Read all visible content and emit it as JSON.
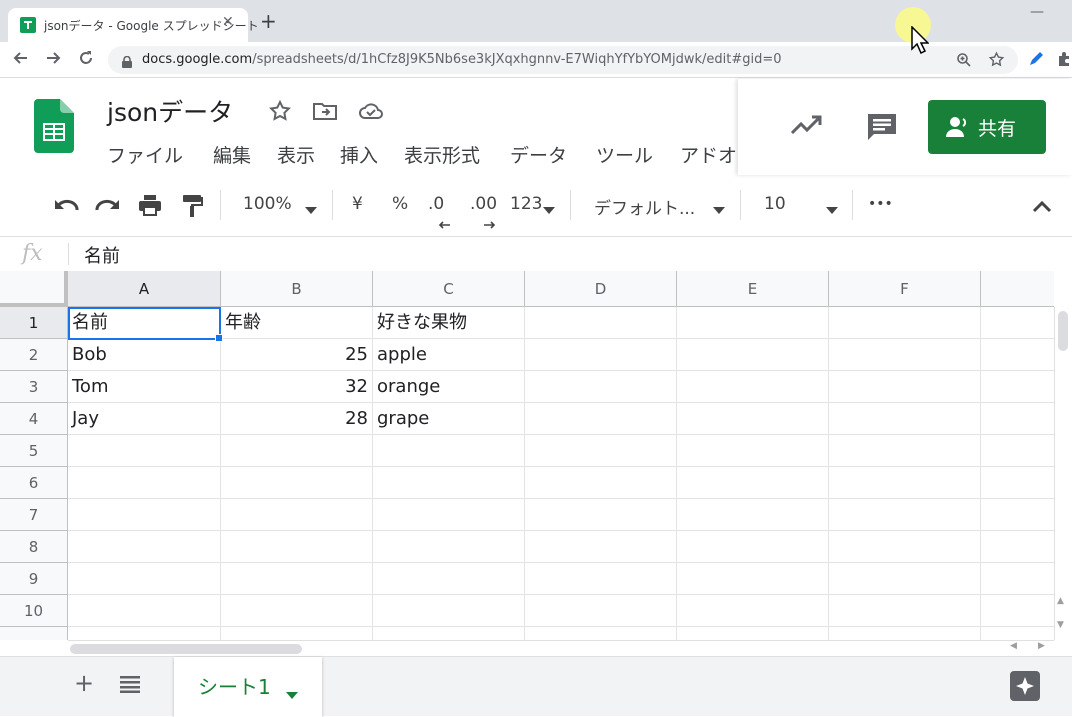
{
  "browser": {
    "tab_title": "jsonデータ - Google スプレッドシート",
    "tab_close": "✕",
    "new_tab": "+",
    "minimize": "—",
    "url_host": "docs.google.com",
    "url_path": "/spreadsheets/d/1hCfz8J9K5Nb6se3kJXqxhgnnv-E7WiqhYfYbYOMjdwk/edit#gid=0"
  },
  "doc": {
    "title": "jsonデータ",
    "menu": [
      "ファイル",
      "編集",
      "表示",
      "挿入",
      "表示形式",
      "データ",
      "ツール",
      "アドオ"
    ],
    "share_label": "共有"
  },
  "toolbar": {
    "zoom": "100%",
    "currency": "¥",
    "percent": "%",
    "decrease_decimal": ".0",
    "increase_decimal": ".00",
    "more_formats": "123",
    "font": "デフォルト...",
    "font_size": "10",
    "more": "•••"
  },
  "formula_bar": {
    "fx": "fx",
    "value": "名前"
  },
  "grid": {
    "columns": [
      "A",
      "B",
      "C",
      "D",
      "E",
      "F"
    ],
    "row_numbers": [
      "1",
      "2",
      "3",
      "4",
      "5",
      "6",
      "7",
      "8",
      "9",
      "10"
    ],
    "rows": [
      [
        "名前",
        "年齢",
        "好きな果物",
        "",
        "",
        ""
      ],
      [
        "Bob",
        "25",
        "apple",
        "",
        "",
        ""
      ],
      [
        "Tom",
        "32",
        "orange",
        "",
        "",
        ""
      ],
      [
        "Jay",
        "28",
        "grape",
        "",
        "",
        ""
      ],
      [
        "",
        "",
        "",
        "",
        "",
        ""
      ],
      [
        "",
        "",
        "",
        "",
        "",
        ""
      ],
      [
        "",
        "",
        "",
        "",
        "",
        ""
      ],
      [
        "",
        "",
        "",
        "",
        "",
        ""
      ],
      [
        "",
        "",
        "",
        "",
        "",
        ""
      ],
      [
        "",
        "",
        "",
        "",
        "",
        ""
      ]
    ],
    "active_cell": "A1"
  },
  "sheet_bar": {
    "add": "+",
    "list": "≡",
    "sheet_name": "シート1"
  },
  "colors": {
    "brand_green": "#188038",
    "selection_blue": "#1a73e8"
  }
}
